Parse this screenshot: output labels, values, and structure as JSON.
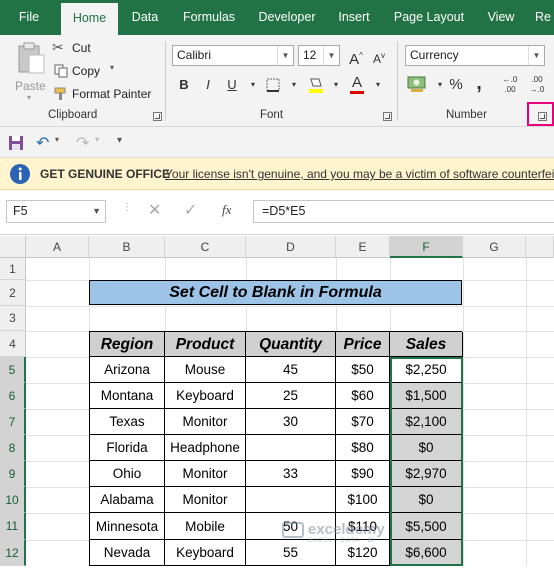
{
  "ribbon_tabs": [
    "File",
    "Home",
    "Data",
    "Formulas",
    "Developer",
    "Insert",
    "Page Layout",
    "View",
    "Re"
  ],
  "clipboard": {
    "paste": "Paste",
    "cut": "Cut",
    "copy": "Copy",
    "format_painter": "Format Painter",
    "label": "Clipboard"
  },
  "font": {
    "name": "Calibri",
    "size": "12",
    "label": "Font",
    "bold": "B",
    "italic": "I",
    "underline": "U"
  },
  "number": {
    "format": "Currency",
    "label": "Number",
    "percent": "%",
    "comma": ","
  },
  "message_bar": {
    "title": "GET GENUINE OFFICE",
    "text": "Your license isn't genuine, and you may be a victim of software counterfeiting"
  },
  "formula_bar": {
    "name_box": "F5",
    "fx": "fx",
    "formula": "=D5*E5"
  },
  "columns": [
    "A",
    "B",
    "C",
    "D",
    "E",
    "F",
    "G"
  ],
  "rows": [
    "1",
    "2",
    "3",
    "4",
    "5",
    "6",
    "7",
    "8",
    "9",
    "10",
    "11",
    "12"
  ],
  "sheet": {
    "title": "Set Cell to Blank in Formula",
    "headers": [
      "Region",
      "Product",
      "Quantity",
      "Price",
      "Sales"
    ],
    "table": [
      [
        "Arizona",
        "Mouse",
        "45",
        "$50",
        "$2,250"
      ],
      [
        "Montana",
        "Keyboard",
        "25",
        "$60",
        "$1,500"
      ],
      [
        "Texas",
        "Monitor",
        "30",
        "$70",
        "$2,100"
      ],
      [
        "Florida",
        "Headphone",
        "",
        "$80",
        "$0"
      ],
      [
        "Ohio",
        "Monitor",
        "33",
        "$90",
        "$2,970"
      ],
      [
        "Alabama",
        "Monitor",
        "",
        "$100",
        "$0"
      ],
      [
        "Minnesota",
        "Mobile",
        "50",
        "$110",
        "$5,500"
      ],
      [
        "Nevada",
        "Keyboard",
        "55",
        "$120",
        "$6,600"
      ]
    ]
  },
  "watermark": {
    "brand": "exceldemy",
    "tagline": "EXCEL · DATA · BI"
  },
  "colors": {
    "excel_green": "#217346",
    "title_fill": "#9dc3e6",
    "header_fill": "#d0d0d0",
    "highlight": "#e6007e"
  }
}
